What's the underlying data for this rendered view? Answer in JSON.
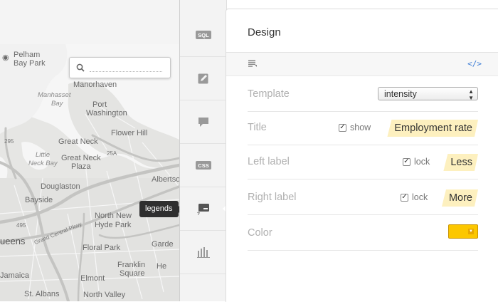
{
  "map": {
    "search_placeholder": "",
    "labels": {
      "pelham": "Pelham",
      "pelham_bay": "Bay Park",
      "manorhaven": "Manorhaven",
      "manhasset": "Manhasset",
      "manhasset_bay": "Bay",
      "port_washington_1": "Port",
      "port_washington_2": "Washington",
      "route_295": "295",
      "flower_hill": "Flower Hill",
      "great_neck": "Great Neck",
      "little_neck_bay_1": "Little",
      "little_neck_bay_2": "Neck Bay",
      "great_neck_plaza_1": "Great Neck",
      "great_neck_plaza_2": "Plaza",
      "route_25a": "25A",
      "albertson": "Albertso",
      "douglaston": "Douglaston",
      "bayside": "Bayside",
      "route_495": "495",
      "north_new_hyde_park_1": "North New",
      "north_new_hyde_park_2": "Hyde Park",
      "queens": "ueens",
      "grand_central_pkwy": "Grand Central Pkwy",
      "floral_park": "Floral Park",
      "garden": "Garde",
      "jamaica": "Jamaica",
      "elmont": "Elmont",
      "franklin_square_1": "Franklin",
      "franklin_square_2": "Square",
      "he": "He",
      "st_albans": "St. Albans",
      "north_valley": "North Valley"
    },
    "tooltip": "legends"
  },
  "toolbar": {
    "tools": [
      "sql",
      "edit",
      "comment",
      "css",
      "legends",
      "chart"
    ],
    "sql_label": "SQL",
    "css_label": "CSS",
    "active": "legends"
  },
  "panel": {
    "title": "Design",
    "code_button": "</>",
    "rows": {
      "template": {
        "label": "Template",
        "value": "intensity"
      },
      "title": {
        "label": "Title",
        "check_label": "show",
        "checked": true,
        "value": "Employment rate"
      },
      "left_label": {
        "label": "Left label",
        "check_label": "lock",
        "checked": true,
        "value": "Less"
      },
      "right_label": {
        "label": "Right label",
        "check_label": "lock",
        "checked": true,
        "value": "More"
      },
      "color": {
        "label": "Color",
        "value": "#fcc700"
      }
    }
  },
  "colors": {
    "accent": "#3a7bd5",
    "tag_bg": "#fdf0bf",
    "swatch": "#fcc700",
    "tooltip_bg": "#2f2f2f"
  }
}
